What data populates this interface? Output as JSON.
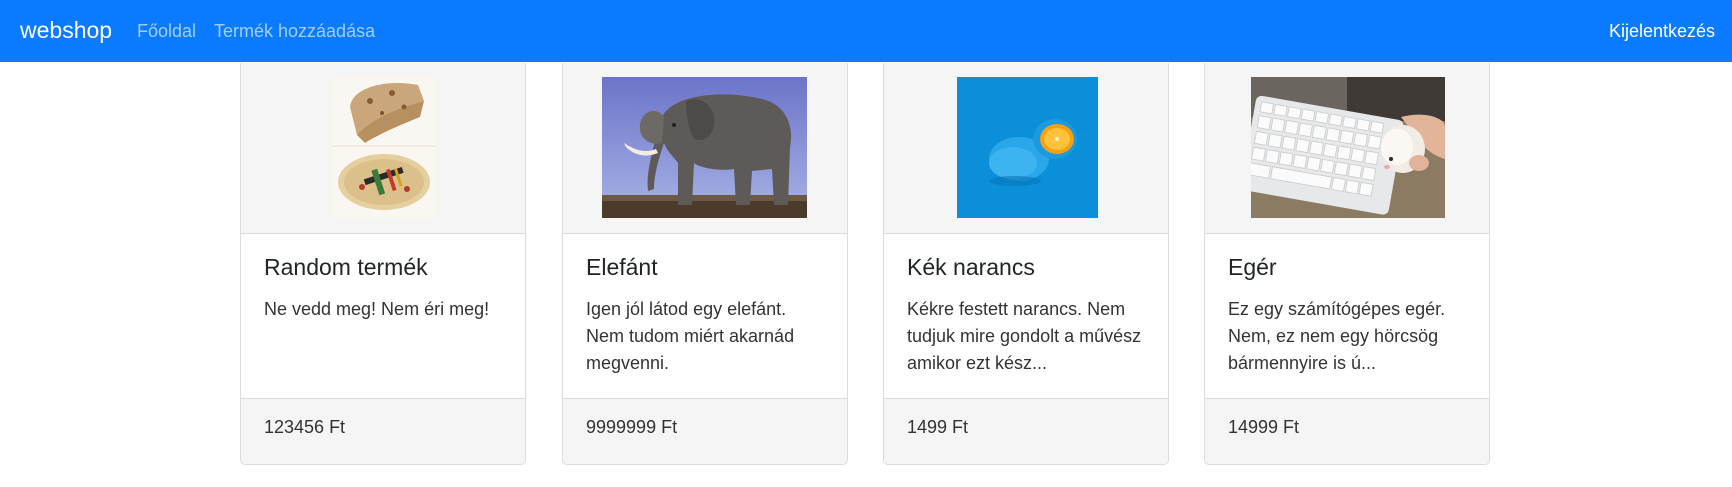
{
  "navbar": {
    "brand": "webshop",
    "links": [
      "Főoldal",
      "Termék hozzáadása"
    ],
    "logout": "Kijelentkezés",
    "color": "#0a7bff"
  },
  "products": [
    {
      "title": "Random termék",
      "description": "Ne vedd meg! Nem éri meg!",
      "price": "123456 Ft",
      "image": "wrap-and-pizza-photo"
    },
    {
      "title": "Elefánt",
      "description": "Igen jól látod egy elefánt. Nem tudom miért akarnád megvenni.",
      "price": "9999999 Ft",
      "image": "elephant-photo"
    },
    {
      "title": "Kék narancs",
      "description": "Kékre festett narancs. Nem tudjuk mire gondolt a művész amikor ezt kész...",
      "price": "1499 Ft",
      "image": "blue-orange-photo"
    },
    {
      "title": "Egér",
      "description": "Ez egy számítógépes egér. Nem, ez nem egy hörcsög bármennyire is ú...",
      "price": "14999 Ft",
      "image": "hamster-mouse-photo"
    }
  ]
}
